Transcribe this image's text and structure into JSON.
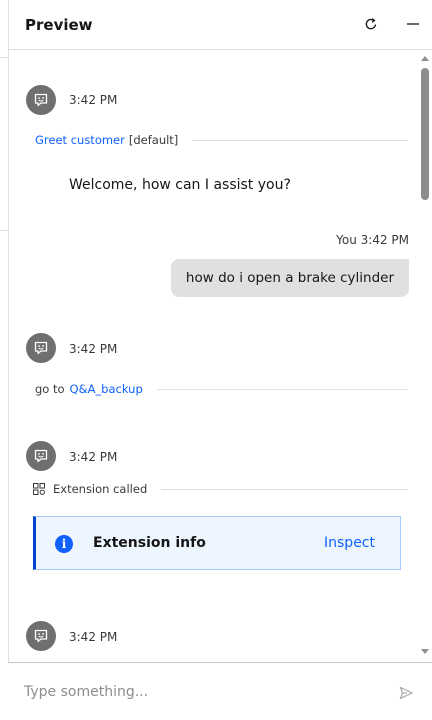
{
  "header": {
    "title": "Preview",
    "refresh_icon": "refresh-icon",
    "minimize_icon": "minimize-icon"
  },
  "messages": {
    "bot_1": {
      "time": "3:42 PM",
      "avatar_icon": "chat-bot-icon"
    },
    "action_1": {
      "link": "Greet customer",
      "tag": "[default]"
    },
    "bot_text_1": "Welcome, how can I assist you?",
    "user_1": {
      "label": "You 3:42 PM",
      "text": "how do i open a brake cylinder"
    },
    "bot_2": {
      "time": "3:42 PM"
    },
    "action_2": {
      "prefix": "go to",
      "link": "Q&A_backup"
    },
    "bot_3": {
      "time": "3:42 PM"
    },
    "action_3": {
      "text": "Extension called",
      "icon": "extension-icon"
    },
    "extension_card": {
      "title": "Extension info",
      "action": "Inspect",
      "icon": "info-icon"
    },
    "bot_4": {
      "time": "3:42 PM"
    }
  },
  "input": {
    "placeholder": "Type something...",
    "value": "",
    "send_icon": "send-icon"
  },
  "colors": {
    "link": "#0f62fe",
    "avatar": "#6f6f6f",
    "user_bubble": "#e0e0e0",
    "card_bg": "#edf5ff",
    "card_accent": "#0043ce"
  }
}
